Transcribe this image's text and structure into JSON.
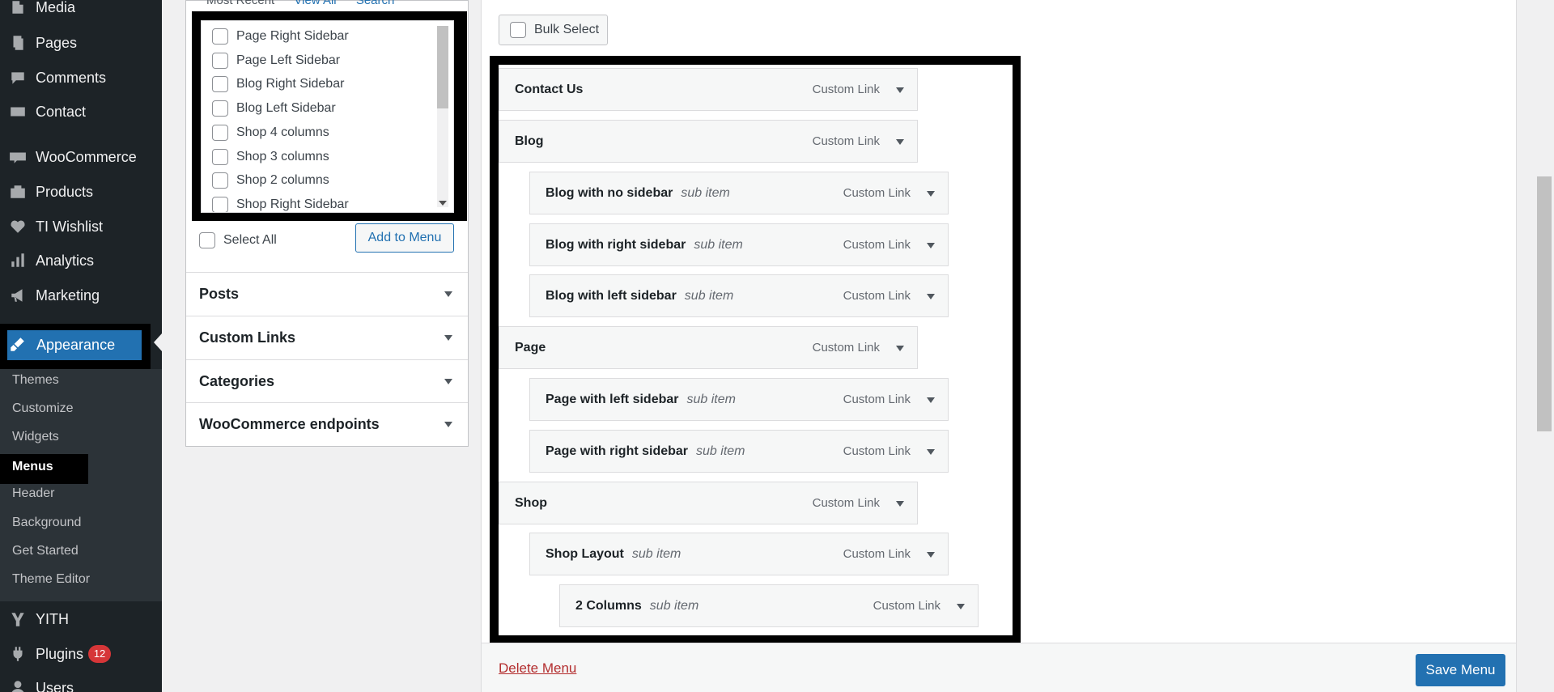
{
  "sidebar": {
    "items": [
      {
        "label": "Media",
        "icon": "media-icon"
      },
      {
        "label": "Pages",
        "icon": "pages-icon"
      },
      {
        "label": "Comments",
        "icon": "comments-icon"
      },
      {
        "label": "Contact",
        "icon": "contact-icon"
      },
      {
        "label": "WooCommerce",
        "icon": "woocommerce-icon"
      },
      {
        "label": "Products",
        "icon": "products-icon"
      },
      {
        "label": "TI Wishlist",
        "icon": "heart-icon"
      },
      {
        "label": "Analytics",
        "icon": "analytics-icon"
      },
      {
        "label": "Marketing",
        "icon": "megaphone-icon"
      }
    ],
    "appearance": "Appearance",
    "submenu": [
      "Themes",
      "Customize",
      "Widgets",
      "Menus",
      "Header",
      "Background",
      "Get Started",
      "Theme Editor"
    ],
    "bottom_items": [
      {
        "label": "YITH",
        "icon": "yith-icon"
      },
      {
        "label": "Plugins",
        "icon": "plugin-icon",
        "badge": "12"
      },
      {
        "label": "Users",
        "icon": "users-icon"
      }
    ]
  },
  "add_items": {
    "tabs": [
      "Most Recent",
      "View All",
      "Search"
    ],
    "pages": [
      "Page Right Sidebar",
      "Page Left Sidebar",
      "Blog Right Sidebar",
      "Blog Left Sidebar",
      "Shop 4 columns",
      "Shop 3 columns",
      "Shop 2 columns",
      "Shop Right Sidebar"
    ],
    "select_all": "Select All",
    "add_button": "Add to Menu",
    "accordions": [
      "Posts",
      "Custom Links",
      "Categories",
      "WooCommerce endpoints"
    ]
  },
  "menu_structure": {
    "bulk_select": "Bulk Select",
    "items": [
      {
        "title": "Contact Us",
        "sub": "",
        "type": "Custom Link",
        "depth": 0
      },
      {
        "title": "Blog",
        "sub": "",
        "type": "Custom Link",
        "depth": 0
      },
      {
        "title": "Blog with no sidebar",
        "sub": "sub item",
        "type": "Custom Link",
        "depth": 1
      },
      {
        "title": "Blog with right sidebar",
        "sub": "sub item",
        "type": "Custom Link",
        "depth": 1
      },
      {
        "title": "Blog with left sidebar",
        "sub": "sub item",
        "type": "Custom Link",
        "depth": 1
      },
      {
        "title": "Page",
        "sub": "",
        "type": "Custom Link",
        "depth": 0
      },
      {
        "title": "Page with left sidebar",
        "sub": "sub item",
        "type": "Custom Link",
        "depth": 1
      },
      {
        "title": "Page with right sidebar",
        "sub": "sub item",
        "type": "Custom Link",
        "depth": 1
      },
      {
        "title": "Shop",
        "sub": "",
        "type": "Custom Link",
        "depth": 0
      },
      {
        "title": "Shop Layout",
        "sub": "sub item",
        "type": "Custom Link",
        "depth": 1
      },
      {
        "title": "2 Columns",
        "sub": "sub item",
        "type": "Custom Link",
        "depth": 2
      }
    ]
  },
  "footer": {
    "delete": "Delete Menu",
    "save": "Save Menu"
  },
  "colors": {
    "accent": "#2271b1",
    "sidebar": "#1d2327",
    "danger": "#b32d2e"
  }
}
